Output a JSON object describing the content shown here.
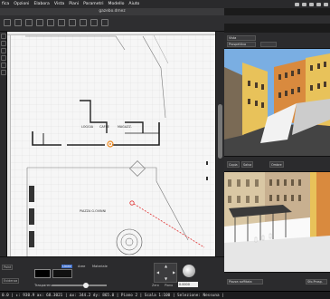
{
  "menubar": {
    "items": [
      "fica",
      "Opzioni",
      "Elabora",
      "Vista",
      "Piani",
      "Parametri",
      "Modello",
      "Aiuto"
    ]
  },
  "window": {
    "title": "gazebo.dmez"
  },
  "plan": {
    "labels": {
      "loggia": "LOGGIA",
      "caffe": "CAFFE",
      "magazzino": "MAGAZZ.",
      "piazza": "PIAZZA G.OVINNI"
    }
  },
  "bottom_panel": {
    "tabs": [
      "Linee",
      "Aree",
      "Materiale"
    ],
    "left_buttons": [
      "Paint",
      "Evidenza"
    ],
    "transparency_label": "Trasparenza",
    "dir_labels": [
      "Zero",
      "Piano"
    ],
    "value_field": "0.0000"
  },
  "statusbar": {
    "text": "0.0 | ↕:    930.9 ax:  68.3021 | Δx:    344.2 dy:    865.0 | Piano 2 | Scala 1:100 | Selezione: Nessuna |"
  },
  "right_panel": {
    "view_select": "Vista",
    "projection_select": "Prospettiva",
    "controls": [
      "Copia",
      "Salva",
      "Ombre"
    ],
    "bottom_select": "Piazza soffitata",
    "bottom_select2": "Sfo.Prosp."
  },
  "colors": {
    "accent_orange": "#f08a1e",
    "marker_red": "#e03030",
    "wall": "#222222",
    "sky": "#7aaee2",
    "facade_yellow": "#e8c25a",
    "facade_orange": "#d98a3e"
  }
}
